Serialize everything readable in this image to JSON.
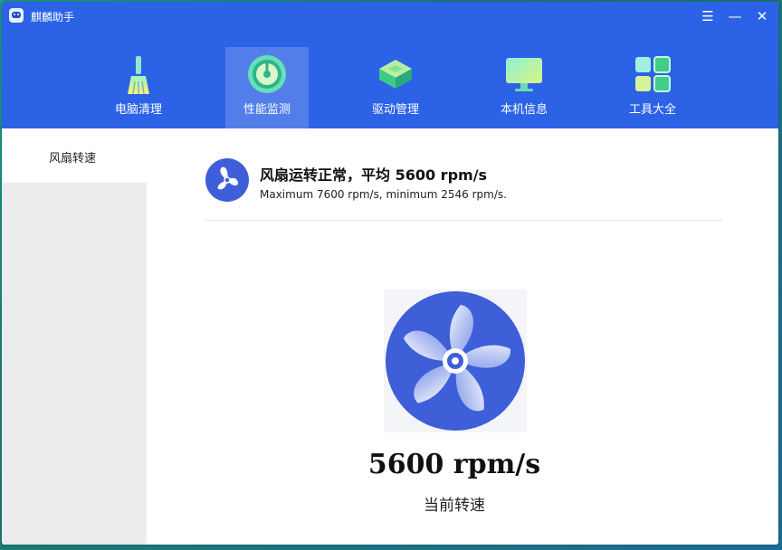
{
  "window": {
    "title": "麒麟助手",
    "controls": {
      "menu": "☰",
      "minimize": "—",
      "close": "✕"
    }
  },
  "nav": {
    "items": [
      {
        "label": "电脑清理",
        "icon": "broom-icon"
      },
      {
        "label": "性能监测",
        "icon": "gauge-icon",
        "active": true
      },
      {
        "label": "驱动管理",
        "icon": "chip-icon"
      },
      {
        "label": "本机信息",
        "icon": "monitor-icon"
      },
      {
        "label": "工具大全",
        "icon": "grid-tools-icon"
      }
    ]
  },
  "sidebar": {
    "items": [
      {
        "label": "风扇转速",
        "active": true
      }
    ]
  },
  "status": {
    "title": "风扇运转正常，平均 5600 rpm/s",
    "subtitle": "Maximum 7600 rpm/s, minimum 2546 rpm/s."
  },
  "fan": {
    "value": "5600 rpm/s",
    "label": "当前转速"
  },
  "colors": {
    "header": "#2c62e6",
    "accent": "#3e5fd8",
    "sidebar": "#ececec"
  }
}
